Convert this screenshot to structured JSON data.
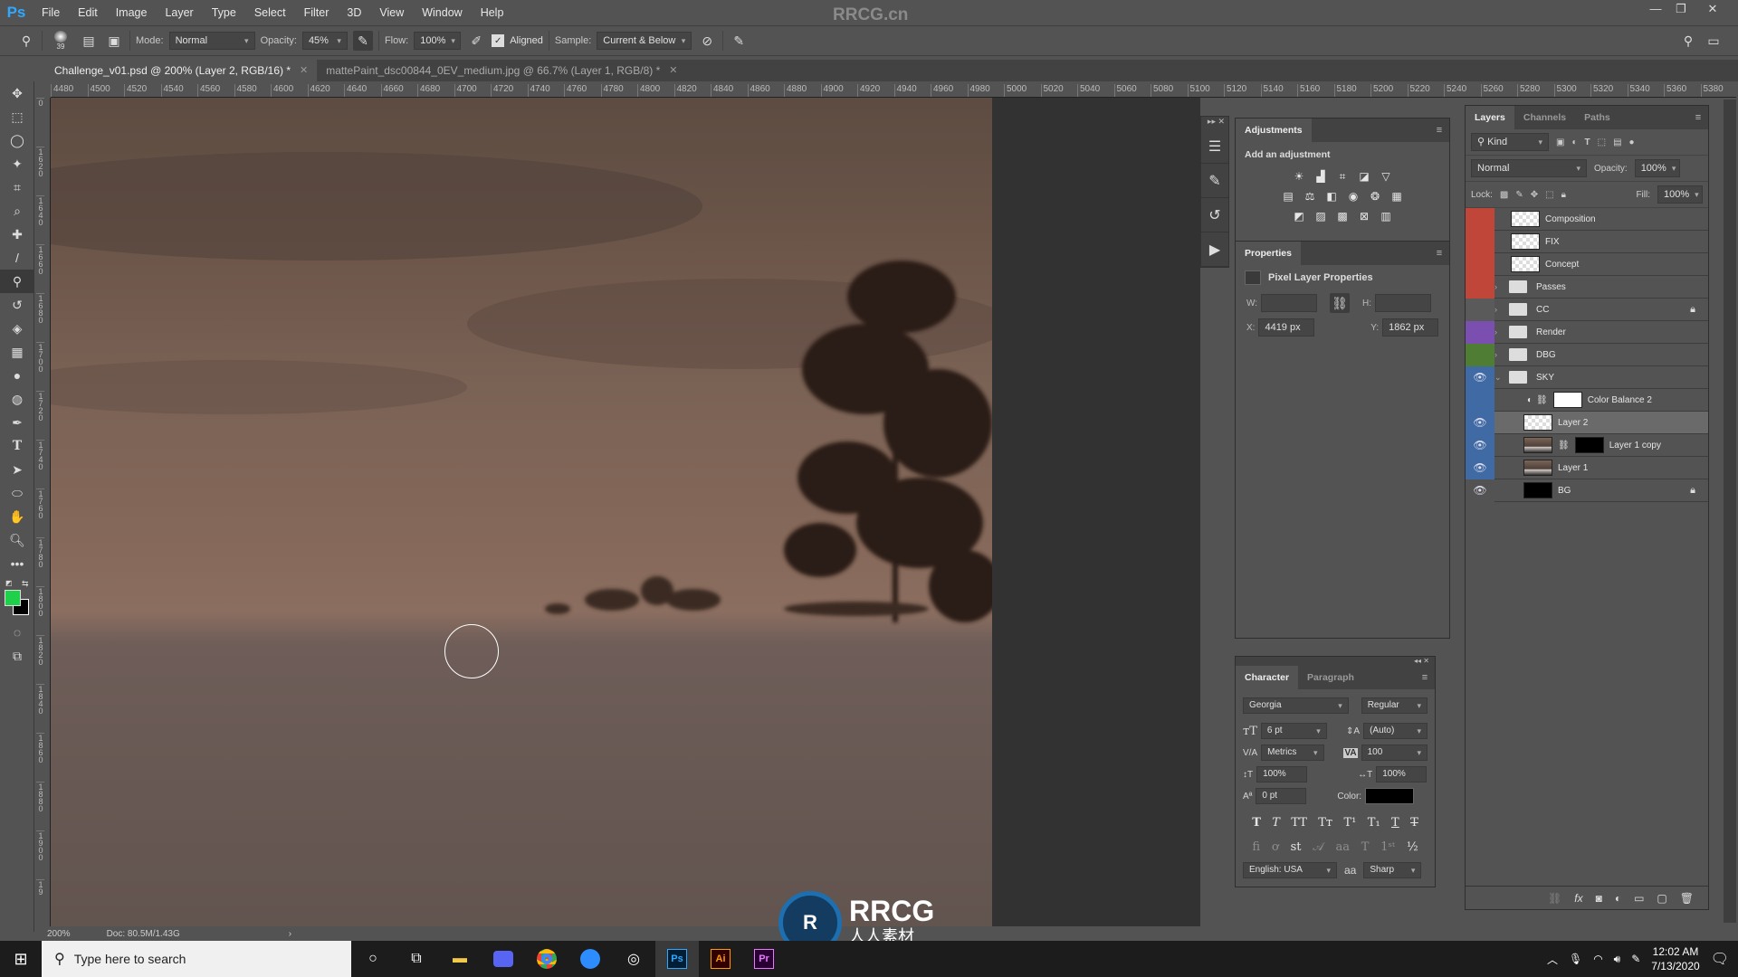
{
  "app": {
    "logo": "Ps",
    "watermark": "RRCG.cn"
  },
  "menu": [
    "File",
    "Edit",
    "Image",
    "Layer",
    "Type",
    "Select",
    "Filter",
    "3D",
    "View",
    "Window",
    "Help"
  ],
  "window_controls": {
    "minimize": "—",
    "restore": "❐",
    "close": "✕"
  },
  "options_bar": {
    "brush_size": "39",
    "mode_label": "Mode:",
    "mode_value": "Normal",
    "opacity_label": "Opacity:",
    "opacity_value": "45%",
    "flow_label": "Flow:",
    "flow_value": "100%",
    "aligned_label": "Aligned",
    "aligned_checked": true,
    "sample_label": "Sample:",
    "sample_value": "Current & Below"
  },
  "tabs": [
    {
      "label": "Challenge_v01.psd @ 200% (Layer 2, RGB/16) *",
      "active": true
    },
    {
      "label": "mattePaint_dsc00844_0EV_medium.jpg @ 66.7% (Layer 1, RGB/8) *",
      "active": false
    }
  ],
  "ruler_h": [
    "4480",
    "4500",
    "4520",
    "4540",
    "4560",
    "4580",
    "4600",
    "4620",
    "4640",
    "4660",
    "4680",
    "4700",
    "4720",
    "4740",
    "4760",
    "4780",
    "4800",
    "4820",
    "4840",
    "4860",
    "4880",
    "4900",
    "4920",
    "4940",
    "4960",
    "4980",
    "5000",
    "5020",
    "5040",
    "5060",
    "5080",
    "5100",
    "5120",
    "5140",
    "5160",
    "5180",
    "5200",
    "5220",
    "5240",
    "5260",
    "5280",
    "5300",
    "5320",
    "5340",
    "5360",
    "5380"
  ],
  "ruler_v": [
    "0",
    "1620",
    "1640",
    "1660",
    "1680",
    "1700",
    "1720",
    "1740",
    "1760",
    "1780",
    "1800",
    "1820",
    "1840",
    "1860",
    "1880",
    "1900",
    "19"
  ],
  "tools": [
    "move",
    "marquee",
    "lasso",
    "magic-wand",
    "crop",
    "eyedropper",
    "healing-brush",
    "brush",
    "clone-stamp",
    "history-brush",
    "eraser",
    "gradient",
    "blur",
    "dodge",
    "pen",
    "type",
    "path-selection",
    "ellipse",
    "hand",
    "zoom",
    "more"
  ],
  "colors": {
    "foreground": "#1fd14a",
    "background": "#000000"
  },
  "status": {
    "zoom": "200%",
    "doc": "Doc: 80.5M/1.43G"
  },
  "adjustments": {
    "tab": "Adjustments",
    "hint": "Add an adjustment"
  },
  "properties": {
    "tab": "Properties",
    "title": "Pixel Layer Properties",
    "w_label": "W:",
    "w_value": "",
    "h_label": "H:",
    "h_value": "",
    "x_label": "X:",
    "x_value": "4419 px",
    "y_label": "Y:",
    "y_value": "1862 px"
  },
  "character": {
    "tabs": [
      "Character",
      "Paragraph"
    ],
    "font": "Georgia",
    "style": "Regular",
    "size": "6 pt",
    "leading": "(Auto)",
    "kerning": "Metrics",
    "tracking": "100",
    "vscale": "100%",
    "hscale": "100%",
    "baseline": "0 pt",
    "color_label": "Color:",
    "color": "#000000",
    "language": "English: USA",
    "antialias": "Sharp",
    "aa_label": "aa"
  },
  "layers": {
    "tabs": [
      "Layers",
      "Channels",
      "Paths"
    ],
    "filter": "Kind",
    "blend": "Normal",
    "opacity_label": "Opacity:",
    "opacity": "100%",
    "lock_label": "Lock:",
    "fill_label": "Fill:",
    "fill": "100%",
    "items": [
      {
        "name": "Composition",
        "type": "layer",
        "tag": "#c0463a",
        "visible": false,
        "thumb": "checker"
      },
      {
        "name": "FIX",
        "type": "layer",
        "tag": "#c0463a",
        "visible": false,
        "thumb": "checker"
      },
      {
        "name": "Concept",
        "type": "layer",
        "tag": "#c0463a",
        "visible": false,
        "thumb": "checker"
      },
      {
        "name": "Passes",
        "type": "group",
        "tag": "#c0463a",
        "visible": false
      },
      {
        "name": "CC",
        "type": "group",
        "tag": "#5a5a5a",
        "visible": false,
        "locked": true
      },
      {
        "name": "Render",
        "type": "group",
        "tag": "#7a4fb0",
        "visible": false
      },
      {
        "name": "DBG",
        "type": "group",
        "tag": "#4f7d34",
        "visible": false
      },
      {
        "name": "SKY",
        "type": "group-open",
        "tag": "#3f6aa4",
        "visible": true
      },
      {
        "name": "Color Balance 2",
        "type": "adjustment",
        "tag": "#3f6aa4",
        "visible": false,
        "thumb": "white"
      },
      {
        "name": "Layer 2",
        "type": "layer",
        "tag": "#3f6aa4",
        "visible": true,
        "thumb": "checker",
        "selected": true
      },
      {
        "name": "Layer 1 copy",
        "type": "layer-mask",
        "tag": "#3f6aa4",
        "visible": true,
        "thumb": "photo"
      },
      {
        "name": "Layer 1",
        "type": "layer",
        "tag": "#3f6aa4",
        "visible": true,
        "thumb": "photo"
      },
      {
        "name": "BG",
        "type": "layer",
        "tag": "#535353",
        "visible": true,
        "thumb": "black",
        "locked": true
      }
    ]
  },
  "taskbar": {
    "search_placeholder": "Type here to search",
    "apps": [
      "cortana",
      "task-view",
      "file-explorer",
      "discord",
      "chrome",
      "zoom",
      "obs",
      "photoshop",
      "illustrator",
      "premiere"
    ],
    "app_labels": {
      "photoshop": "Ps",
      "illustrator": "Ai",
      "premiere": "Pr"
    },
    "time": "12:02 AM",
    "date": "7/13/2020"
  },
  "overlay_logo": {
    "text": "RRCG",
    "sub": "人人素材"
  }
}
